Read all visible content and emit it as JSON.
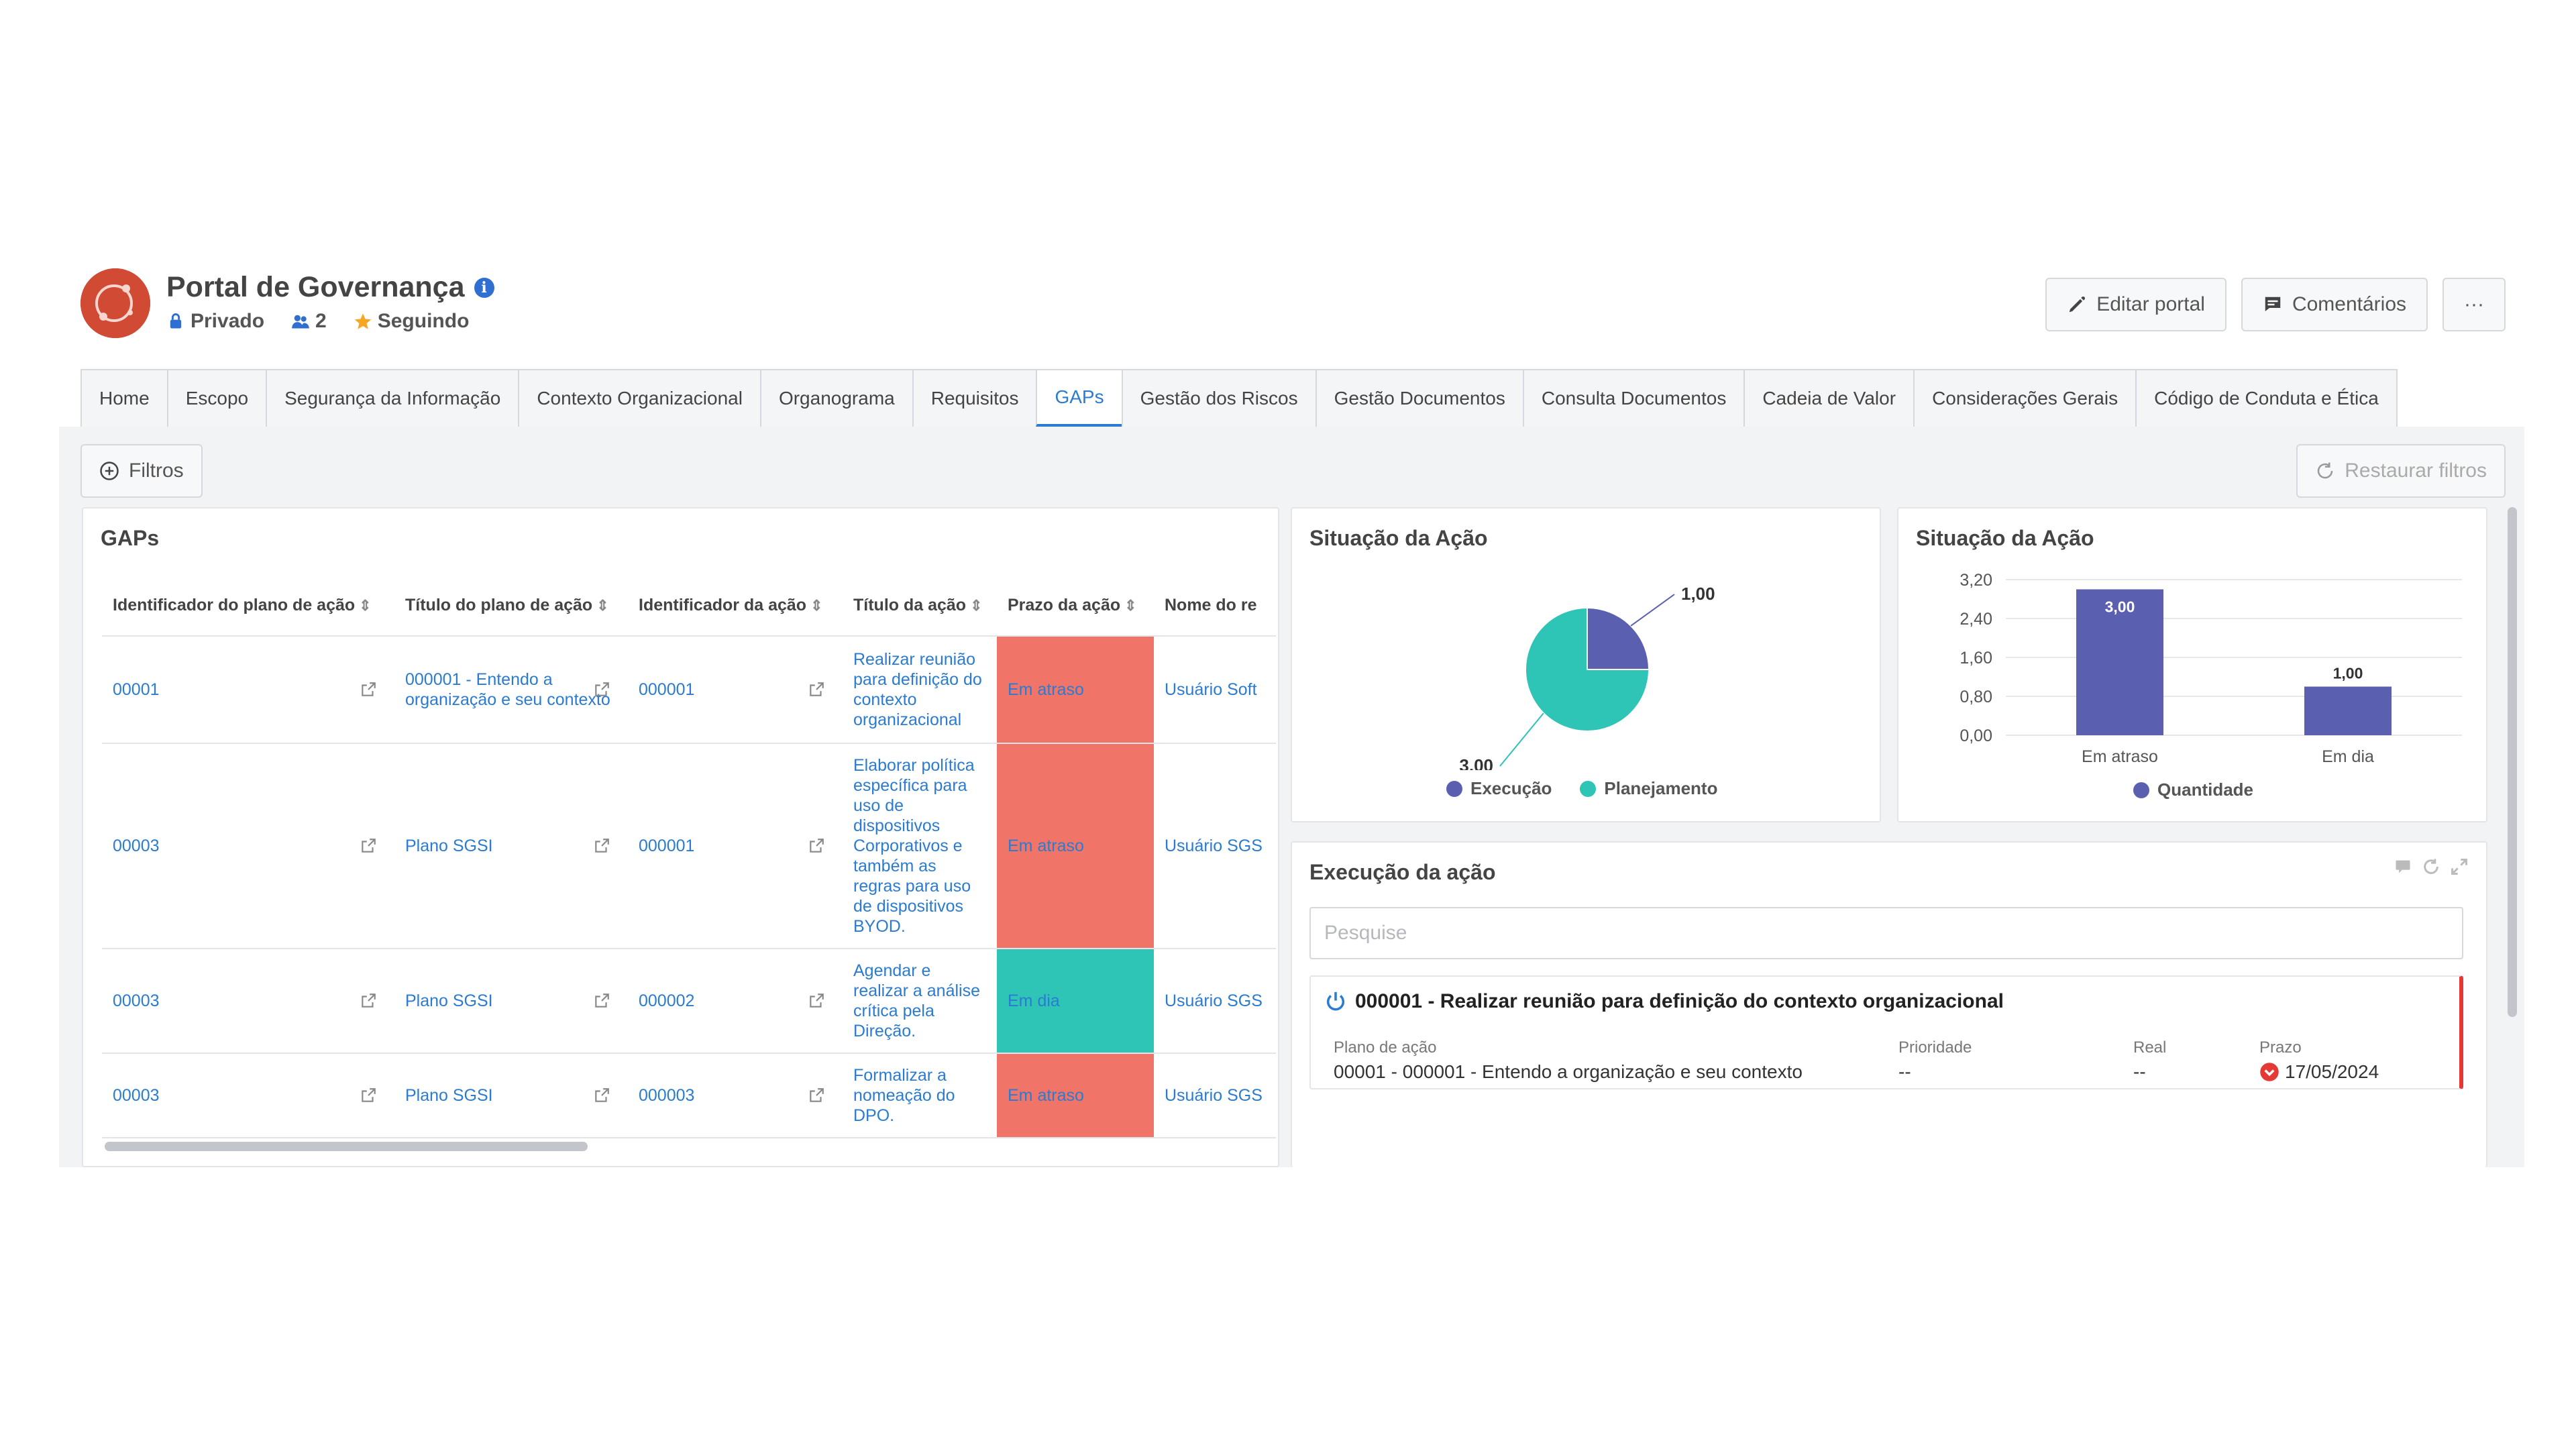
{
  "portal": {
    "title": "Portal de Governança",
    "visibility": "Privado",
    "members": "2",
    "following": "Seguindo",
    "edit_label": "Editar portal",
    "comments_label": "Comentários",
    "more_label": "···"
  },
  "tabs": [
    "Home",
    "Escopo",
    "Segurança da Informação",
    "Contexto Organizacional",
    "Organograma",
    "Requisitos",
    "GAPs",
    "Gestão dos Riscos",
    "Gestão Documentos",
    "Consulta Documentos",
    "Cadeia de Valor",
    "Considerações Gerais",
    "Código de Conduta e Ética"
  ],
  "active_tab": "GAPs",
  "toolbar": {
    "filters_label": "Filtros",
    "restore_label": "Restaurar filtros"
  },
  "gaps": {
    "title": "GAPs",
    "columns": [
      "Identificador do plano de ação",
      "Título do plano de ação",
      "Identificador da ação",
      "Título da ação",
      "Prazo da ação",
      "Nome do re"
    ],
    "rows": [
      {
        "plan_id": "00001",
        "plan_title": "000001 - Entendo a organização e seu contexto",
        "action_id": "000001",
        "action_title": "Realizar reunião para definição do contexto organizacional",
        "deadline": "Em atraso",
        "owner": "Usuário Soft"
      },
      {
        "plan_id": "00003",
        "plan_title": "Plano SGSI",
        "action_id": "000001",
        "action_title": "Elaborar política específica para uso de dispositivos Corporativos e também as regras para uso de dispositivos BYOD.",
        "deadline": "Em atraso",
        "owner": "Usuário SGS"
      },
      {
        "plan_id": "00003",
        "plan_title": "Plano SGSI",
        "action_id": "000002",
        "action_title": "Agendar e realizar a análise crítica pela Direção.",
        "deadline": "Em dia",
        "owner": "Usuário SGS"
      },
      {
        "plan_id": "00003",
        "plan_title": "Plano SGSI",
        "action_id": "000003",
        "action_title": "Formalizar a nomeação do DPO.",
        "deadline": "Em atraso",
        "owner": "Usuário SGS"
      }
    ]
  },
  "chart_data": [
    {
      "type": "pie",
      "title": "Situação da Ação",
      "categories": [
        "Execução",
        "Planejamento"
      ],
      "values": [
        1.0,
        3.0
      ],
      "value_labels": [
        "1,00",
        "3,00"
      ],
      "colors": [
        "#5b5fb0",
        "#2ec4b6"
      ],
      "legend": "bottom"
    },
    {
      "type": "bar",
      "title": "Situação da Ação",
      "categories": [
        "Em atraso",
        "Em dia"
      ],
      "series": [
        {
          "name": "Quantidade",
          "values": [
            3.0,
            1.0
          ]
        }
      ],
      "value_labels": [
        "3,00",
        "1,00"
      ],
      "y_ticks": [
        "3,20",
        "2,40",
        "1,60",
        "0,80",
        "0,00"
      ],
      "ylim": [
        0,
        3.2
      ],
      "color": "#5b5fb0",
      "grid": true,
      "legend": "bottom"
    }
  ],
  "execution": {
    "title": "Execução da ação",
    "search_placeholder": "Pesquise",
    "item": {
      "title": "000001 - Realizar reunião para definição do contexto organizacional",
      "plan_label": "Plano de ação",
      "plan_value": "00001 - 000001 - Entendo a organização e seu contexto",
      "priority_label": "Prioridade",
      "priority_value": "--",
      "real_label": "Real",
      "real_value": "--",
      "deadline_label": "Prazo",
      "deadline_value": "17/05/2024"
    }
  },
  "colors": {
    "accent": "#2b7bd1",
    "late": "#f07468",
    "on_time": "#2ec4b6",
    "chart_primary": "#5b5fb0",
    "alert": "#e53935"
  }
}
